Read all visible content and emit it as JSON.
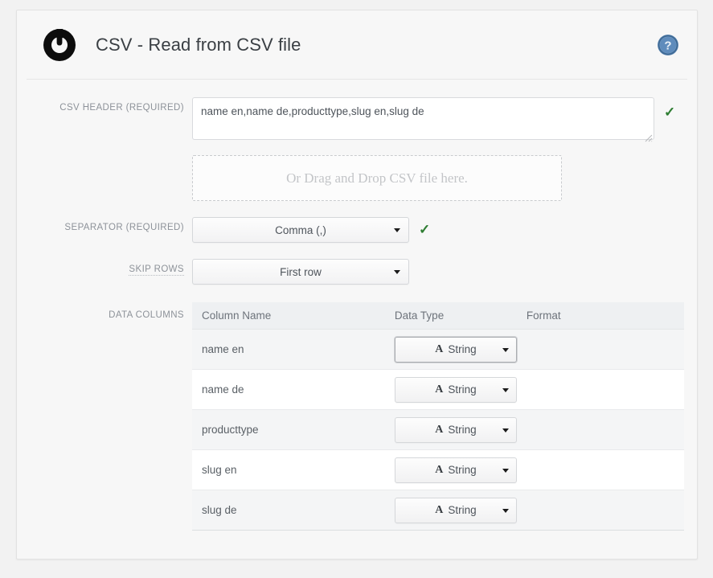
{
  "header": {
    "title": "CSV - Read from CSV file",
    "logo_icon": "spiral-circle-logo",
    "help_icon": "question-mark-help-icon"
  },
  "form": {
    "csv_header": {
      "label": "CSV HEADER (REQUIRED)",
      "value": "name en,name de,producttype,slug en,slug de",
      "placeholder": "",
      "valid_icon": "✓"
    },
    "dropzone": {
      "text": "Or Drag and Drop CSV file here."
    },
    "separator": {
      "label": "SEPARATOR (REQUIRED)",
      "value": "Comma (,)",
      "valid_icon": "✓"
    },
    "skip_rows": {
      "label": "SKIP ROWS",
      "value": "First row"
    },
    "data_columns": {
      "label": "DATA COLUMNS",
      "columns": [
        "Column Name",
        "Data Type",
        "Format"
      ],
      "rows": [
        {
          "name": "name en",
          "type": "String",
          "type_glyph": "A",
          "format": ""
        },
        {
          "name": "name de",
          "type": "String",
          "type_glyph": "A",
          "format": ""
        },
        {
          "name": "producttype",
          "type": "String",
          "type_glyph": "A",
          "format": ""
        },
        {
          "name": "slug en",
          "type": "String",
          "type_glyph": "A",
          "format": ""
        },
        {
          "name": "slug de",
          "type": "String",
          "type_glyph": "A",
          "format": ""
        }
      ]
    }
  },
  "colors": {
    "page_bg": "#f2f2f2",
    "panel_bg": "#f7f7f7",
    "accent_valid": "#2e7d32",
    "help_blue": "#4a7fb5",
    "label_gray": "#8d9299",
    "text_gray": "#4e545b",
    "table_header_bg": "#eef0f2"
  }
}
